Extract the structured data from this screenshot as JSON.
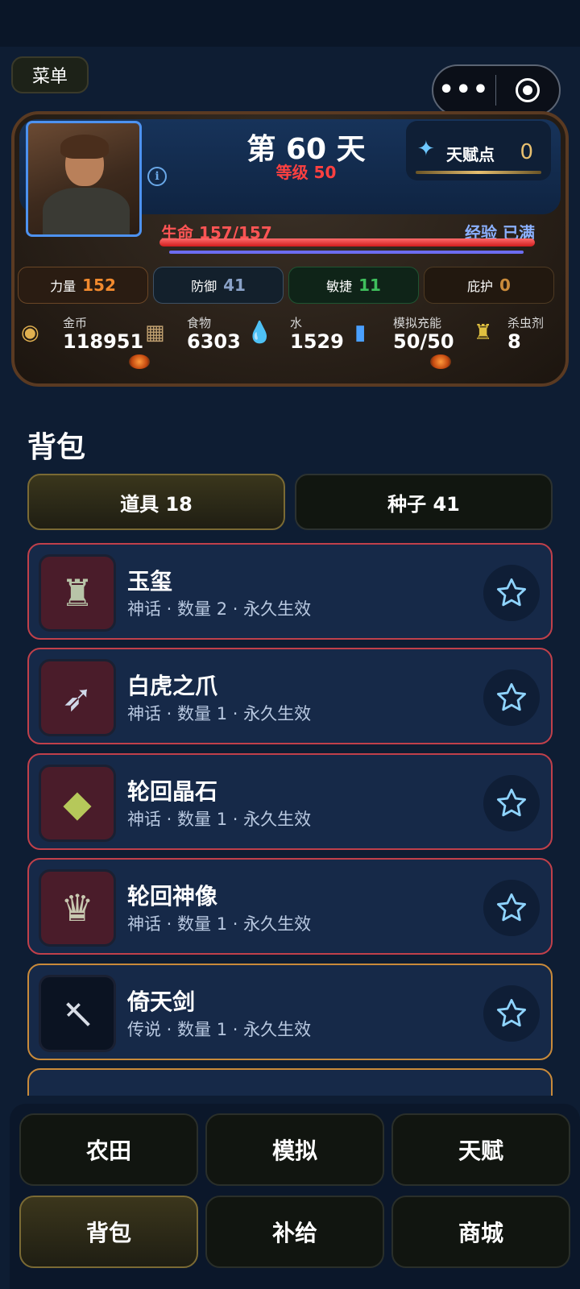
{
  "header": {
    "menu_label": "菜单",
    "more_icon": "more-dots-icon",
    "close_icon": "target-icon"
  },
  "status": {
    "day": "第 60 天",
    "level": "等级 50",
    "talent_label": "天赋点",
    "talent_value": "0",
    "life_label": "生命 157/157",
    "life_fraction": 1.0,
    "exp_label": "经验 已满",
    "exp_fraction": 1.0,
    "stats": [
      {
        "label": "力量",
        "value": "152",
        "color": "#f28a2e"
      },
      {
        "label": "防御",
        "value": "41",
        "color": "#8aa2c8"
      },
      {
        "label": "敏捷",
        "value": "11",
        "color": "#3fbf5c"
      },
      {
        "label": "庇护",
        "value": "0",
        "color": "#c98a3a"
      }
    ],
    "resources": [
      {
        "label": "金币",
        "value": "118951",
        "icon": "coins-icon"
      },
      {
        "label": "食物",
        "value": "6303",
        "icon": "food-icon"
      },
      {
        "label": "水",
        "value": "1529",
        "icon": "water-icon"
      },
      {
        "label": "模拟充能",
        "value": "50/50",
        "icon": "battery-icon"
      },
      {
        "label": "杀虫剂",
        "value": "8",
        "icon": "spray-icon"
      }
    ]
  },
  "backpack": {
    "title": "背包",
    "tabs": [
      {
        "label": "道具 18"
      },
      {
        "label": "种子 41"
      }
    ],
    "items": [
      {
        "name": "玉玺",
        "meta": "神话 · 数量 2 · 永久生效",
        "rarity": "myth",
        "icon": "jade-seal-icon"
      },
      {
        "name": "白虎之爪",
        "meta": "神话 · 数量 1 · 永久生效",
        "rarity": "myth",
        "icon": "tiger-claw-icon"
      },
      {
        "name": "轮回晶石",
        "meta": "神话 · 数量 1 · 永久生效",
        "rarity": "myth",
        "icon": "crystal-icon"
      },
      {
        "name": "轮回神像",
        "meta": "神话 · 数量 1 · 永久生效",
        "rarity": "myth",
        "icon": "statue-icon"
      },
      {
        "name": "倚天剑",
        "meta": "传说 · 数量 1 · 永久生效",
        "rarity": "legend",
        "icon": "sword-icon"
      }
    ]
  },
  "nav": [
    {
      "label": "农田"
    },
    {
      "label": "模拟"
    },
    {
      "label": "天赋"
    },
    {
      "label": "背包"
    },
    {
      "label": "补给"
    },
    {
      "label": "商城"
    }
  ]
}
